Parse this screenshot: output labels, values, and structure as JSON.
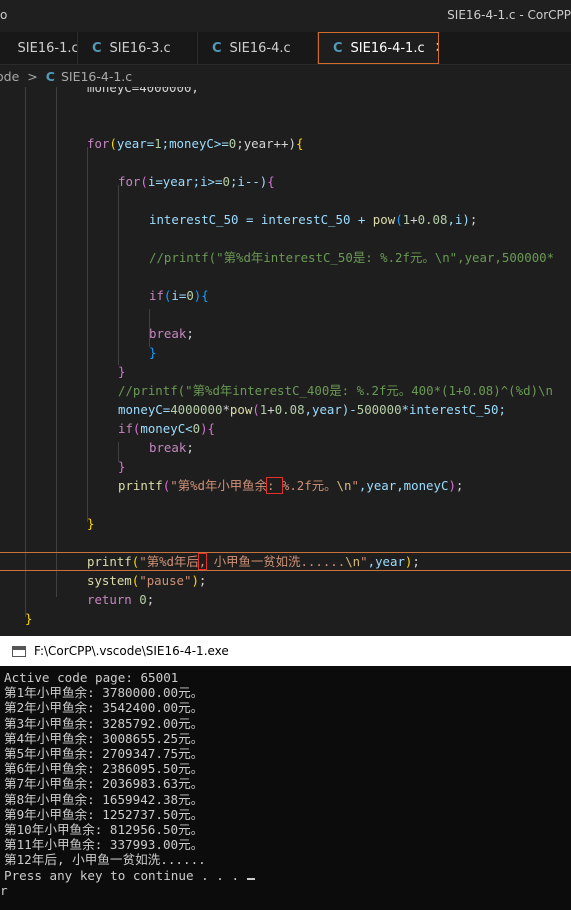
{
  "window": {
    "title": "SIE16-4-1.c - CorCPP",
    "left_fragment": "o"
  },
  "tabs": [
    {
      "icon": "C",
      "label": "SIE16-1.c"
    },
    {
      "icon": "C",
      "label": "SIE16-3.c"
    },
    {
      "icon": "C",
      "label": "SIE16-4.c"
    },
    {
      "icon": "C",
      "label": "SIE16-4-1.c",
      "close": "✕"
    }
  ],
  "breadcrumb": {
    "folder": "ode",
    "file_icon": "C",
    "file": "SIE16-4-1.c"
  },
  "code": {
    "l0": "moneyC=4000000;",
    "l1_kw": "for",
    "l1_a": "(",
    "l1_b": "year=",
    "l1_c": "1",
    "l1_d": ";moneyC>=",
    "l1_e": "0",
    "l1_f": ";year++)",
    "l1_g": "{",
    "l2_kw": "for",
    "l2_a": "(",
    "l2_b": "i=year;i>=",
    "l2_c": "0",
    "l2_d": ";i--)",
    "l2_e": "{",
    "l3_a": "interestC_50 = interestC_50 + ",
    "l3_fn": "pow",
    "l3_b": "(",
    "l3_c": "1",
    "l3_d": "+",
    "l3_e": "0.08",
    "l3_f": ",i)",
    "l3_g": ";",
    "l4": "//printf(\"第%d年interestC_50是: %.2f元。\\n\",year,500000*",
    "l5_kw": "if",
    "l5_a": "(",
    "l5_b": "i=",
    "l5_c": "0",
    "l5_d": ")",
    "l5_e": "{",
    "l6_kw": "break",
    "l6_a": ";",
    "l7": "}",
    "l8": "}",
    "l9": "//printf(\"第%d年interestC_400是: %.2f元。400*(1+0.08)^(%d)\\n",
    "l10_a": "moneyC=",
    "l10_b": "4000000",
    "l10_c": "*",
    "l10_fn": "pow",
    "l10_d": "(",
    "l10_e": "1",
    "l10_f": "+",
    "l10_g": "0.08",
    "l10_h": ",year)-",
    "l10_i": "500000",
    "l10_j": "*interestC_50;",
    "l11_kw": "if",
    "l11_a": "(",
    "l11_b": "moneyC<",
    "l11_c": "0",
    "l11_d": ")",
    "l11_e": "{",
    "l12_kw": "break",
    "l12_a": ";",
    "l13": "}",
    "l14_fn": "printf",
    "l14_a": "(",
    "l14_s1": "\"第%d年小甲鱼余",
    "l14_box": ": ",
    "l14_s2": "%.2f元。",
    "l14_esc": "\\n",
    "l14_s3": "\"",
    "l14_b": ",year,moneyC",
    "l14_c": ")",
    "l14_d": ";",
    "l15": "}",
    "l16_fn": "printf",
    "l16_a": "(",
    "l16_s1": "\"第%d年后",
    "l16_box": ",",
    "l16_s2": " 小甲鱼一贫如洗......",
    "l16_esc": "\\n",
    "l16_s3": "\"",
    "l16_b": ",year",
    "l16_c": ")",
    "l16_d": ";",
    "l17_fn": "system",
    "l17_a": "(",
    "l17_s": "\"pause\"",
    "l17_b": ")",
    "l17_c": ";",
    "l18_kw": "return",
    "l18_a": " ",
    "l18_b": "0",
    "l18_c": ";",
    "l19": "}"
  },
  "console": {
    "title": "F:\\CorCPP\\.vscode\\SIE16-4-1.exe",
    "lines": [
      "Active code page: 65001",
      "第1年小甲鱼余: 3780000.00元。",
      "第2年小甲鱼余: 3542400.00元。",
      "第3年小甲鱼余: 3285792.00元。",
      "第4年小甲鱼余: 3008655.25元。",
      "第5年小甲鱼余: 2709347.75元。",
      "第6年小甲鱼余: 2386095.50元。",
      "第7年小甲鱼余: 2036983.63元。",
      "第8年小甲鱼余: 1659942.38元。",
      "第9年小甲鱼余: 1252737.50元。",
      "第10年小甲鱼余: 812956.50元。",
      "第11年小甲鱼余: 337993.00元。",
      "第12年后, 小甲鱼一贫如洗......",
      "Press any key to continue . . . "
    ],
    "trailing": "r"
  }
}
